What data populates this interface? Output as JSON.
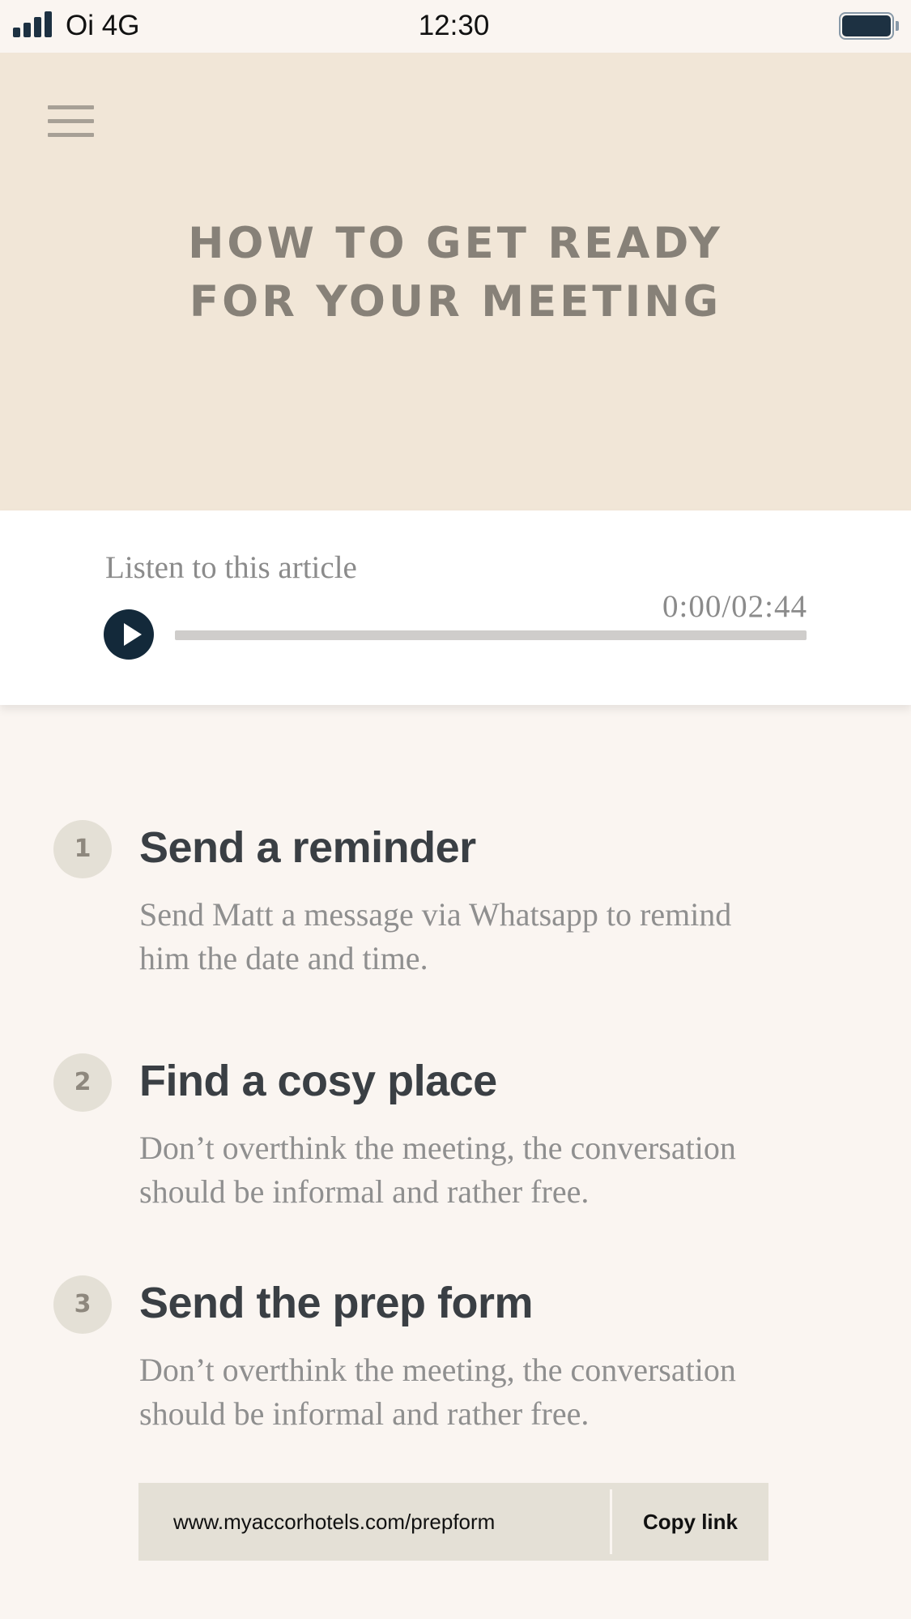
{
  "status_bar": {
    "carrier": "Oi 4G",
    "time": "12:30"
  },
  "hero": {
    "menu_icon": "hamburger-menu-icon",
    "title_line1": "HOW TO GET READY",
    "title_line2": "FOR YOUR MEETING"
  },
  "audio": {
    "label": "Listen to this article",
    "time": "0:00/02:44",
    "progress_fraction": 0,
    "play_icon": "play-icon"
  },
  "steps": [
    {
      "number": "1",
      "title": "Send a reminder",
      "desc_line1": "Send Matt a message via Whatsapp to remind",
      "desc_line2": "him the date and time."
    },
    {
      "number": "2",
      "title": "Find a cosy place",
      "desc_line1": "Don’t overthink the meeting, the conversation",
      "desc_line2": "should be informal and rather free."
    },
    {
      "number": "3",
      "title": "Send the prep form",
      "desc_line1": "Don’t overthink the meeting, the conversation",
      "desc_line2": "should be informal and rather free."
    }
  ],
  "link": {
    "url": "www.myaccorhotels.com/prepform",
    "copy_label": "Copy link"
  },
  "colors": {
    "hero_background": "#f1e6d7",
    "page_background": "#faf5f1",
    "accent_dark": "#13293a",
    "badge_background": "#e4e0d6"
  }
}
